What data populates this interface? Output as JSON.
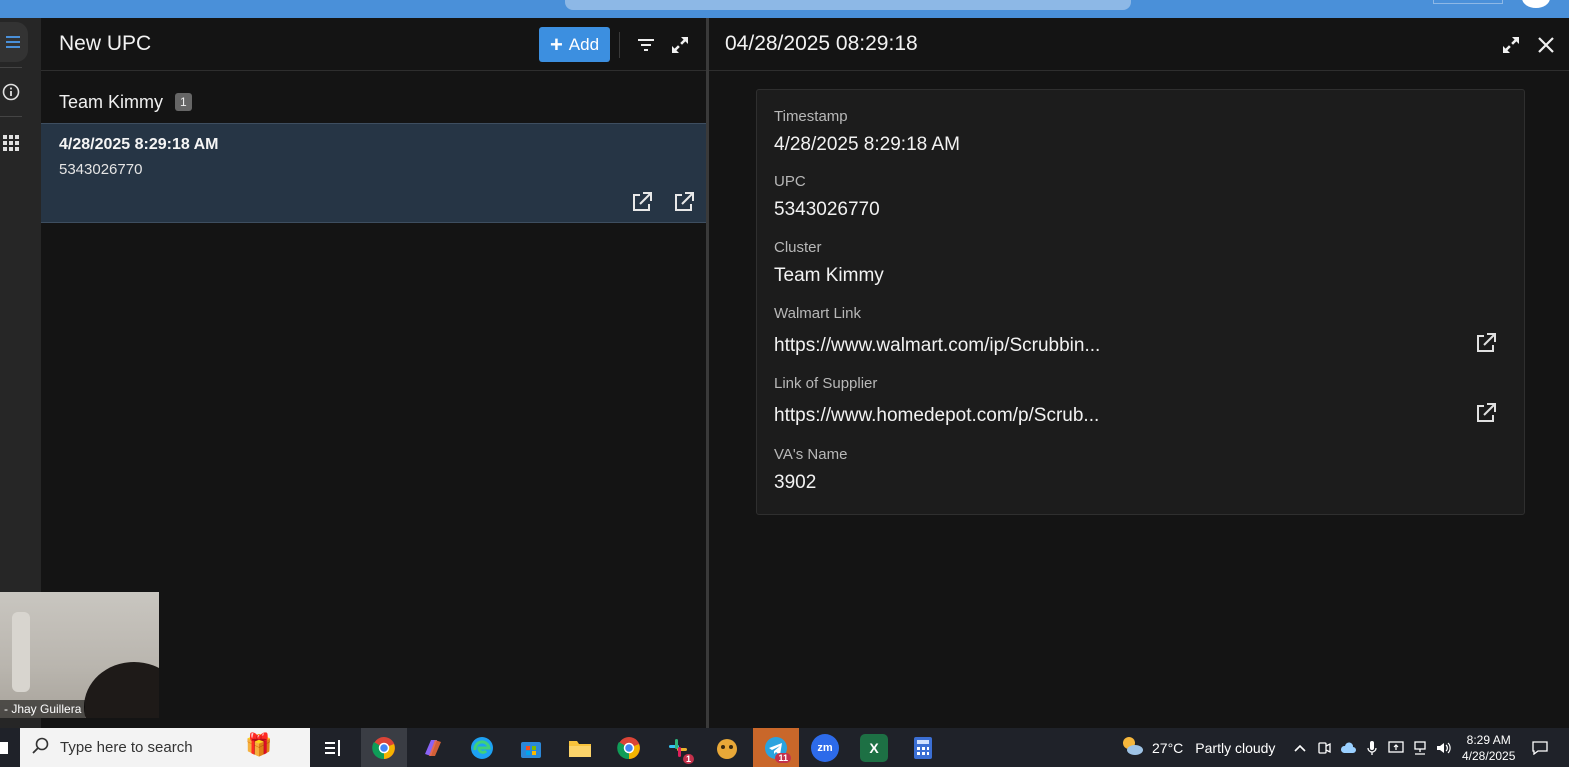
{
  "left_panel": {
    "title": "New UPC",
    "add_label": "Add",
    "group": {
      "name": "Team Kimmy",
      "count": "1"
    },
    "record": {
      "timestamp": "4/28/2025 8:29:18 AM",
      "upc": "5343026770"
    }
  },
  "right_panel": {
    "title": "04/28/2025 08:29:18",
    "fields": [
      {
        "label": "Timestamp",
        "value": "4/28/2025 8:29:18 AM"
      },
      {
        "label": "UPC",
        "value": "5343026770"
      },
      {
        "label": "Cluster",
        "value": "Team Kimmy"
      },
      {
        "label": "Walmart Link",
        "value": "https://www.walmart.com/ip/Scrubbin..."
      },
      {
        "label": "Link of Supplier",
        "value": "https://www.homedepot.com/p/Scrub..."
      },
      {
        "label": "VA's Name",
        "value": "3902"
      }
    ]
  },
  "video": {
    "participant": "- Jhay Guillera"
  },
  "taskbar": {
    "search_placeholder": "Type here to search",
    "weather": {
      "temp": "27°C",
      "condition": "Partly cloudy"
    },
    "clock": {
      "time": "8:29 AM",
      "date": "4/28/2025"
    },
    "badges": {
      "slack": "1",
      "telegram": "11"
    }
  },
  "colors": {
    "accent": "#3c8fe0",
    "selected_row": "#263545",
    "background": "#141414"
  }
}
